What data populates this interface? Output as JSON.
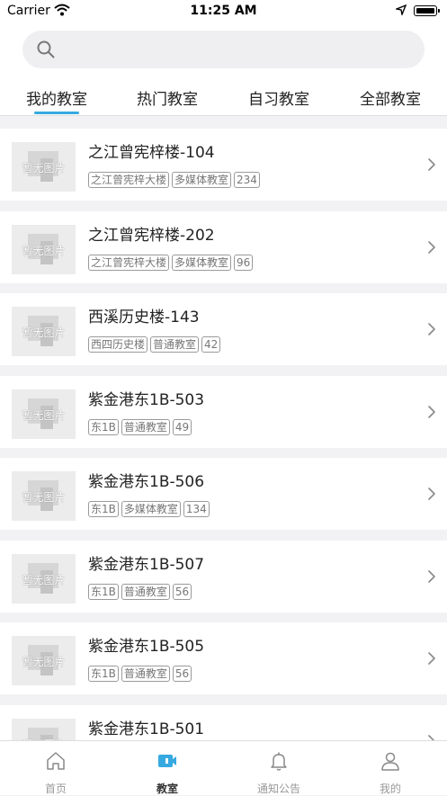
{
  "status_bar": {
    "carrier": "Carrier",
    "time": "11:25 AM"
  },
  "search": {
    "placeholder": ""
  },
  "tabs": [
    {
      "label": "我的教室",
      "active": true
    },
    {
      "label": "热门教室",
      "active": false
    },
    {
      "label": "自习教室",
      "active": false
    },
    {
      "label": "全部教室",
      "active": false
    }
  ],
  "placeholder_image_text": "暂无图片",
  "classrooms": [
    {
      "name": "之江曾宪梓楼-104",
      "tags": [
        "之江曾宪梓大楼",
        "多媒体教室",
        "234"
      ]
    },
    {
      "name": "之江曾宪梓楼-202",
      "tags": [
        "之江曾宪梓大楼",
        "多媒体教室",
        "96"
      ]
    },
    {
      "name": "西溪历史楼-143",
      "tags": [
        "西四历史楼",
        "普通教室",
        "42"
      ]
    },
    {
      "name": "紫金港东1B-503",
      "tags": [
        "东1B",
        "普通教室",
        "49"
      ]
    },
    {
      "name": "紫金港东1B-506",
      "tags": [
        "东1B",
        "多媒体教室",
        "134"
      ]
    },
    {
      "name": "紫金港东1B-507",
      "tags": [
        "东1B",
        "普通教室",
        "56"
      ]
    },
    {
      "name": "紫金港东1B-505",
      "tags": [
        "东1B",
        "普通教室",
        "56"
      ]
    },
    {
      "name": "紫金港东1B-501",
      "tags": []
    }
  ],
  "bottom_nav": [
    {
      "label": "首页",
      "icon": "home-icon",
      "active": false
    },
    {
      "label": "教室",
      "icon": "classroom-icon",
      "active": true
    },
    {
      "label": "通知公告",
      "icon": "bell-icon",
      "active": false
    },
    {
      "label": "我的",
      "icon": "person-icon",
      "active": false
    }
  ],
  "colors": {
    "accent": "#36a9e1",
    "background": "#f2f2f4"
  }
}
